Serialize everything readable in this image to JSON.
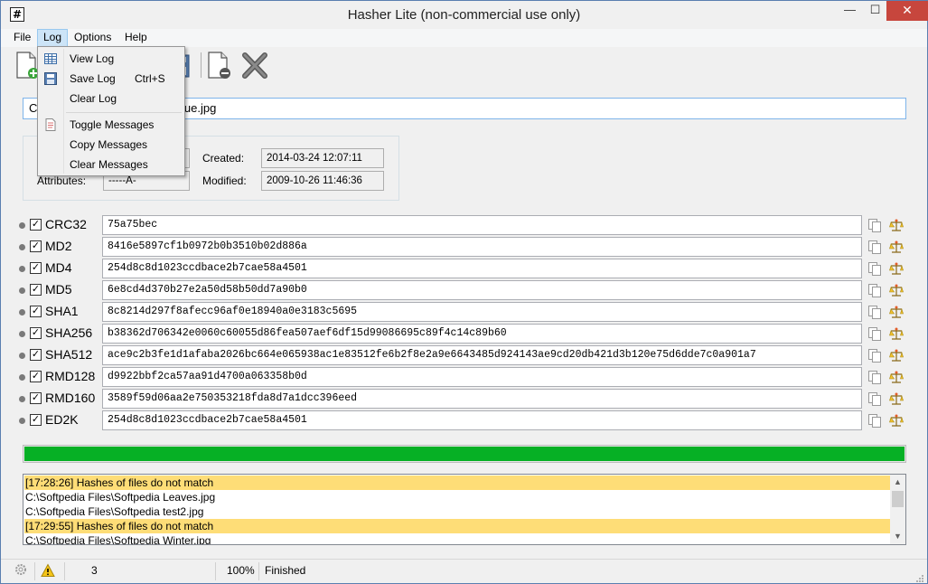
{
  "window": {
    "title": "Hasher Lite (non-commercial use only)",
    "icon_glyph": "#",
    "controls": {
      "minimize": "—",
      "maximize": "☐",
      "close": "✕"
    }
  },
  "menubar": {
    "items": [
      "File",
      "Log",
      "Options",
      "Help"
    ],
    "active": "Log"
  },
  "log_menu": {
    "items": [
      {
        "label": "View Log",
        "shortcut": "",
        "icon": "table-icon"
      },
      {
        "label": "Save Log",
        "shortcut": "Ctrl+S",
        "icon": "save-log-icon"
      },
      {
        "label": "Clear Log",
        "shortcut": "",
        "icon": ""
      },
      {
        "label": "Toggle Messages",
        "shortcut": "",
        "icon": "document-icon"
      },
      {
        "label": "Copy Messages",
        "shortcut": "",
        "icon": ""
      },
      {
        "label": "Clear Messages",
        "shortcut": "",
        "icon": ""
      }
    ]
  },
  "toolbar": {
    "buttons": [
      "add-file-icon",
      "save-icon",
      "remove-file-icon",
      "cancel-icon"
    ]
  },
  "file": {
    "path_visible": "C:",
    "path_visible_suffix": "lue.jpg",
    "attributes_label": "Attributes:",
    "attributes_value": "-----A-",
    "created_label": "Created:",
    "created_value": "2014-03-24 12:07:11",
    "modified_label": "Modified:",
    "modified_value": "2009-10-26 11:46:36"
  },
  "hashes": [
    {
      "name": "CRC32",
      "checked": true,
      "value": "75a75bec"
    },
    {
      "name": "MD2",
      "checked": true,
      "value": "8416e5897cf1b0972b0b3510b02d886a"
    },
    {
      "name": "MD4",
      "checked": true,
      "value": "254d8c8d1023ccdbace2b7cae58a4501"
    },
    {
      "name": "MD5",
      "checked": true,
      "value": "6e8cd4d370b27e2a50d58b50dd7a90b0"
    },
    {
      "name": "SHA1",
      "checked": true,
      "value": "8c8214d297f8afecc96af0e18940a0e3183c5695"
    },
    {
      "name": "SHA256",
      "checked": true,
      "value": "b38362d706342e0060c60055d86fea507aef6df15d99086695c89f4c14c89b60"
    },
    {
      "name": "SHA512",
      "checked": true,
      "value": "ace9c2b3fe1d1afaba2026bc664e065938ac1e83512fe6b2f8e2a9e6643485d924143ae9cd20db421d3b120e75d6dde7c0a901a7"
    },
    {
      "name": "RMD128",
      "checked": true,
      "value": "d9922bbf2ca57aa91d4700a063358b0d"
    },
    {
      "name": "RMD160",
      "checked": true,
      "value": "3589f59d06aa2e750353218fda8d7a1dcc396eed"
    },
    {
      "name": "ED2K",
      "checked": true,
      "value": "254d8c8d1023ccdbace2b7cae58a4501"
    }
  ],
  "progress": {
    "fraction": 1.0,
    "color": "#06b025"
  },
  "log": {
    "lines": [
      {
        "text": "[17:28:26] Hashes of files do not match",
        "highlight": true
      },
      {
        "text": "C:\\Softpedia Files\\Softpedia Leaves.jpg",
        "highlight": false
      },
      {
        "text": "C:\\Softpedia Files\\Softpedia test2.jpg",
        "highlight": false
      },
      {
        "text": "[17:29:55] Hashes of files do not match",
        "highlight": true
      },
      {
        "text": "C:\\Softpedia Files\\Softpedia Winter.jpg",
        "highlight": false
      }
    ],
    "highlight_color": "#fedd77"
  },
  "statusbar": {
    "count": "3",
    "percent": "100%",
    "status": "Finished"
  }
}
